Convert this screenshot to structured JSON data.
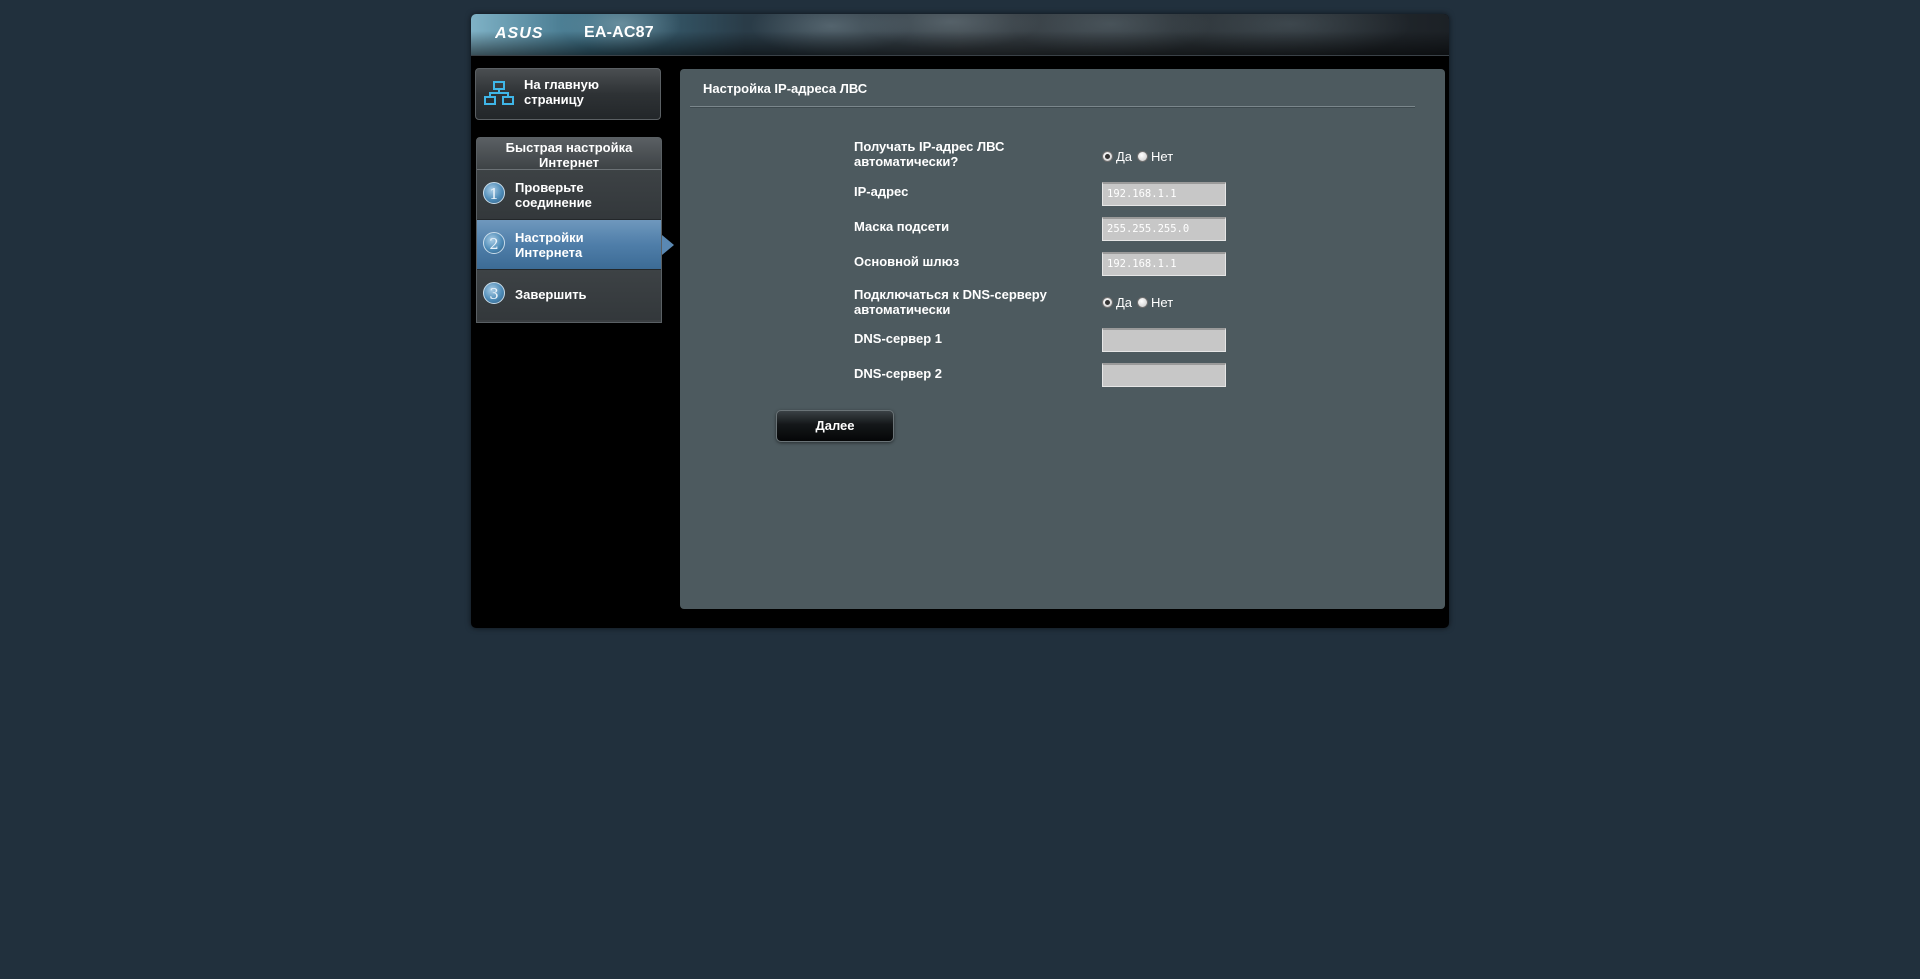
{
  "brand": {
    "logo": "ASUS",
    "model": "EA-AC87"
  },
  "sidebar": {
    "home_label": "На главную страницу",
    "home_icon": "network-icon",
    "quick_setup_title": "Быстрая настройка Интернет",
    "steps": [
      {
        "number": "1",
        "label": "Проверьте соединение",
        "active": false
      },
      {
        "number": "2",
        "label": "Настройки Интернета",
        "active": true
      },
      {
        "number": "3",
        "label": "Завершить",
        "active": false
      }
    ]
  },
  "panel": {
    "title": "Настройка IP-адреса ЛВС",
    "fields": {
      "auto_ip": {
        "label": "Получать IP-адрес ЛВС автоматически?",
        "yes_label": "Да",
        "no_label": "Нет",
        "selected": "yes"
      },
      "ip_address": {
        "label": "IP-адрес",
        "value": "192.168.1.1"
      },
      "subnet_mask": {
        "label": "Маска подсети",
        "value": "255.255.255.0"
      },
      "gateway": {
        "label": "Основной шлюз",
        "value": "192.168.1.1"
      },
      "auto_dns": {
        "label": "Подключаться к DNS-серверу автоматически",
        "yes_label": "Да",
        "no_label": "Нет",
        "selected": "yes"
      },
      "dns1": {
        "label": "DNS-сервер 1",
        "value": ""
      },
      "dns2": {
        "label": "DNS-сервер 2",
        "value": ""
      }
    },
    "next_label": "Далее"
  },
  "colors": {
    "page_background": "#21303d",
    "panel_background": "#4d5a5f",
    "active_step": "#4f7ea9"
  }
}
